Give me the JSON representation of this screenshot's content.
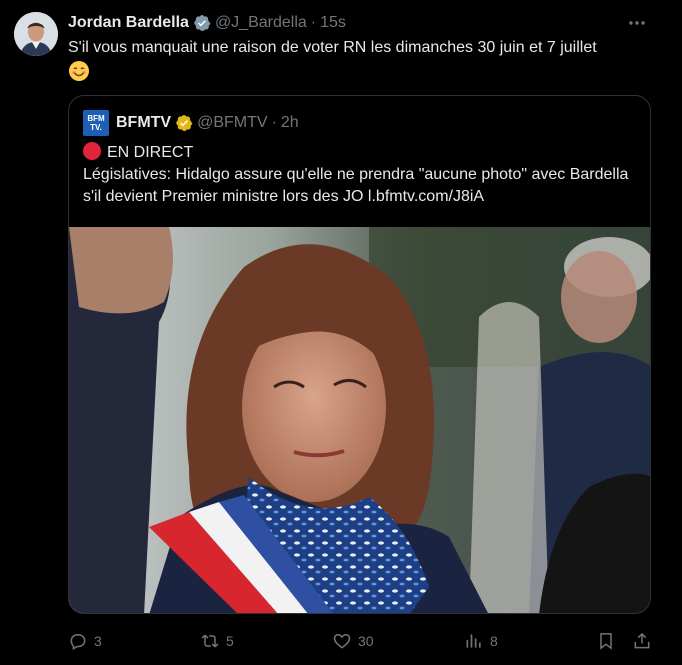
{
  "post": {
    "author_name": "Jordan Bardella",
    "author_handle": "@J_Bardella",
    "separator": "·",
    "time": "15s",
    "text": "S'il vous manquait une raison de voter RN les dimanches 30 juin et 7 juillet",
    "emoji": "smiling-face-emoji"
  },
  "quoted": {
    "logo_line1": "BFM",
    "logo_line2": "TV.",
    "author_name": "BFMTV",
    "author_handle": "@BFMTV",
    "separator": "·",
    "time": "2h",
    "live_label": "EN DIRECT",
    "text": "Législatives: Hidalgo assure qu'elle ne prendra \"aucune photo\" avec Bardella s'il devient Premier ministre lors des JO l.bfmtv.com/J8iA"
  },
  "actions": {
    "replies": "3",
    "reposts": "5",
    "likes": "30",
    "views": "8"
  },
  "colors": {
    "background": "#000000",
    "text": "#e7e9ea",
    "muted": "#71767b",
    "border": "#2f3336",
    "verified_grey": "#829aab",
    "verified_gold": "#e2b719",
    "live_red": "#e0243b"
  }
}
